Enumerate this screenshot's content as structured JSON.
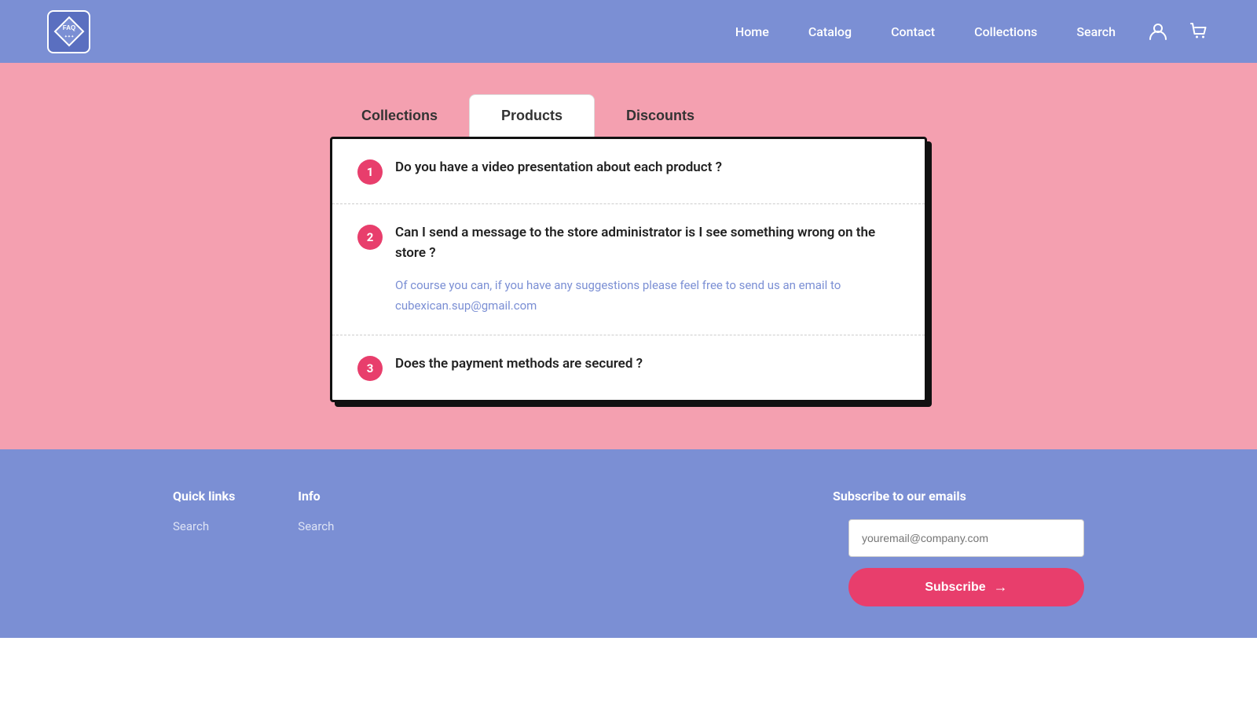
{
  "header": {
    "logo_text": "FAQ",
    "nav": {
      "home": "Home",
      "catalog": "Catalog",
      "contact": "Contact",
      "collections": "Collections",
      "search": "Search"
    }
  },
  "tabs": [
    {
      "id": "collections",
      "label": "Collections",
      "active": false
    },
    {
      "id": "products",
      "label": "Products",
      "active": true
    },
    {
      "id": "discounts",
      "label": "Discounts",
      "active": false
    }
  ],
  "faq_items": [
    {
      "number": "1",
      "question": "Do you have a video presentation about each product ?",
      "answer": null
    },
    {
      "number": "2",
      "question": "Can I send a message to the store administrator is I see something wrong on the store ?",
      "answer": "Of course you can, if you have any suggestions please feel free to send us an email to cubexican.sup@gmail.com"
    },
    {
      "number": "3",
      "question": "Does the payment methods are secured ?",
      "answer": null
    }
  ],
  "footer": {
    "quick_links": {
      "title": "Quick links",
      "links": [
        {
          "label": "Search",
          "href": "#"
        }
      ]
    },
    "info": {
      "title": "Info",
      "links": [
        {
          "label": "Search",
          "href": "#"
        }
      ]
    },
    "subscribe": {
      "title": "Subscribe to our emails",
      "placeholder": "youremail@company.com",
      "button_label": "Subscribe"
    }
  }
}
